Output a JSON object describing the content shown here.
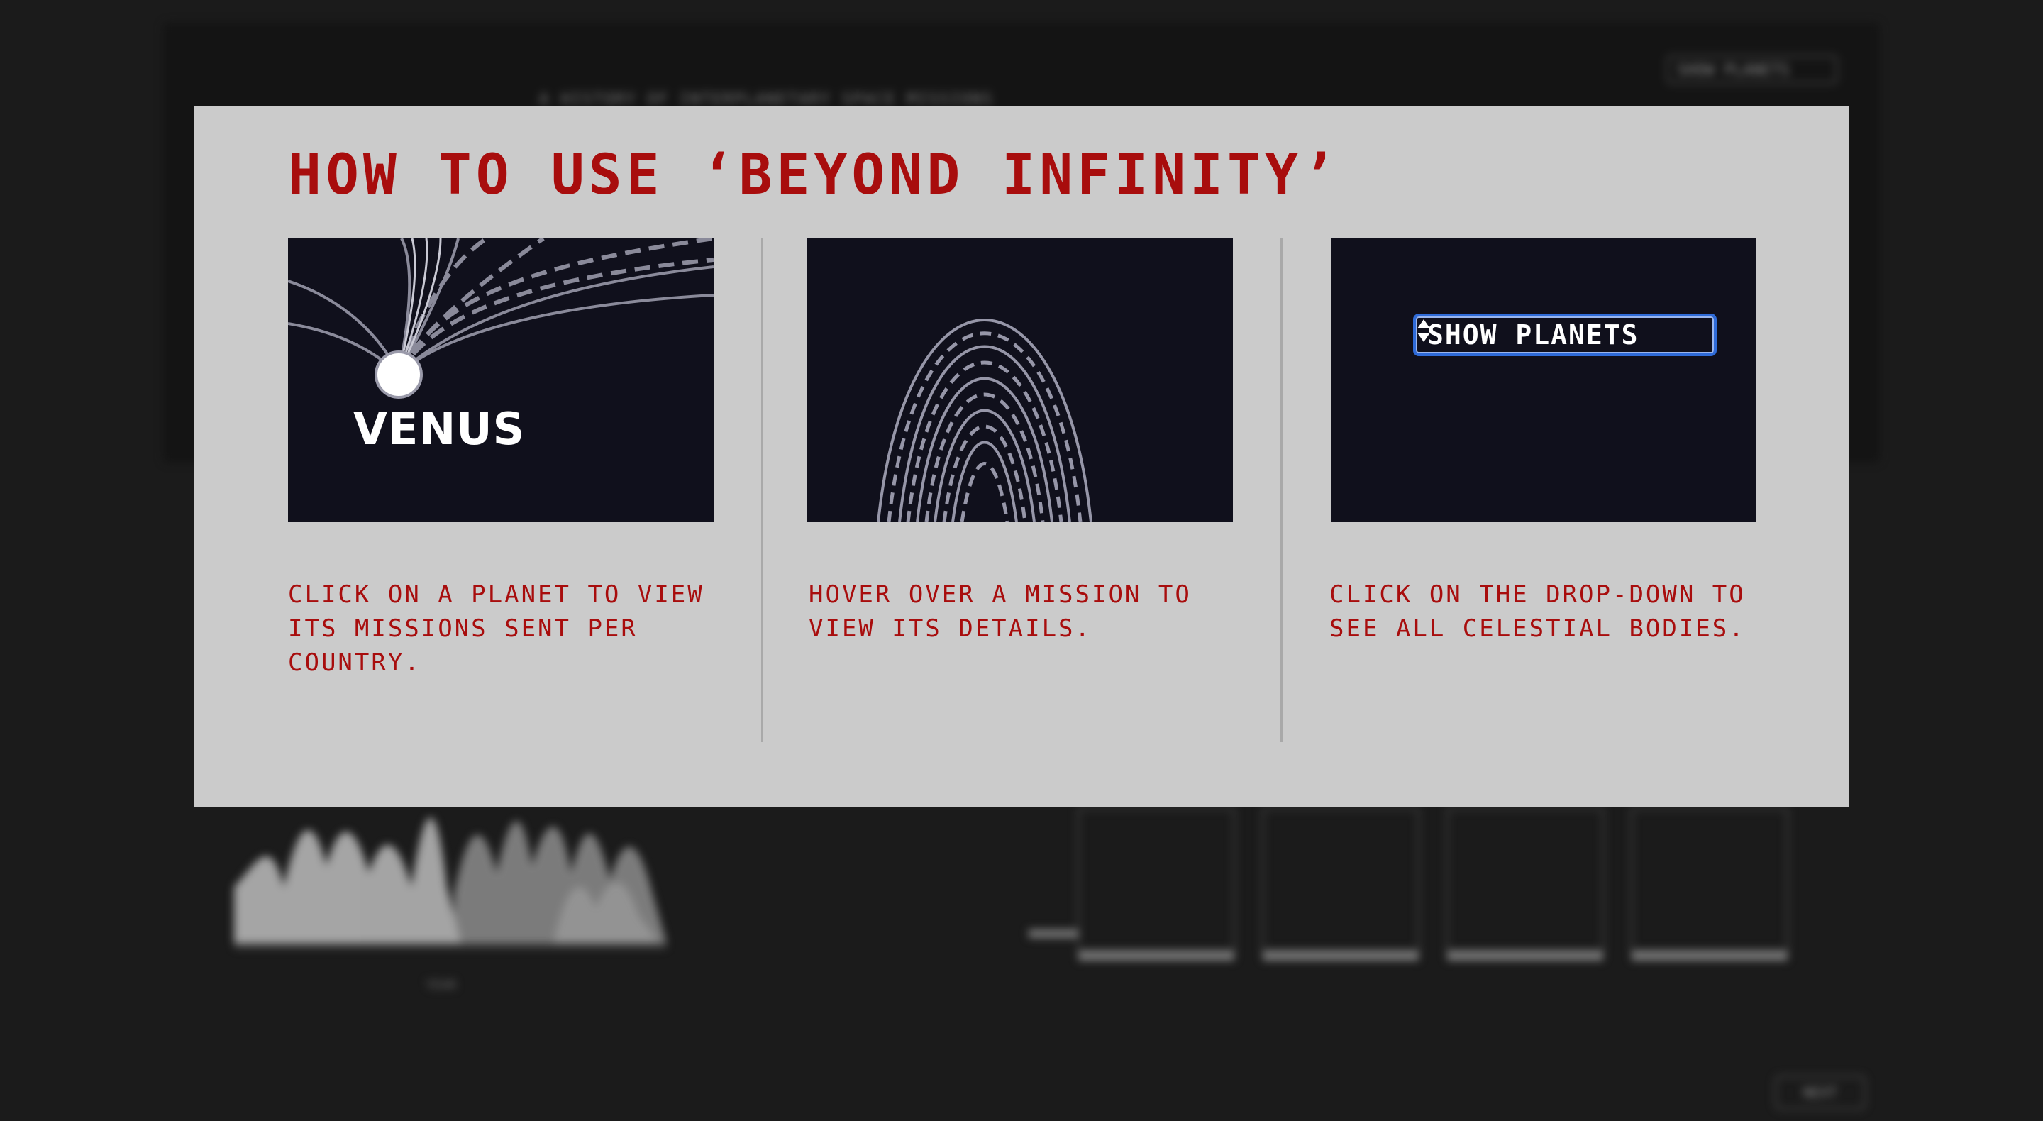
{
  "background": {
    "dropdown_value": "SHOW PLANETS",
    "header_text": "A HISTORY OF INTERPLANETARY SPACE MISSIONS",
    "next_button_label": "NEXT",
    "x_axis_label": "YEAR"
  },
  "modal": {
    "title": "HOW TO USE ‘BEYOND INFINITY’",
    "steps": [
      {
        "preview_label": "VENUS",
        "caption": "CLICK ON A PLANET TO VIEW ITS MISSIONS SENT PER COUNTRY."
      },
      {
        "caption": "HOVER OVER A MISSION TO VIEW ITS DETAILS."
      },
      {
        "preview_select_value": "SHOW PLANETS",
        "caption": "CLICK ON THE DROP-DOWN TO SEE ALL CELESTIAL BODIES."
      }
    ]
  },
  "colors": {
    "title_red": "#a80d0d",
    "modal_bg": "#cbcbcb",
    "tile_bg": "#10101c",
    "select_border": "#2f6bd8"
  }
}
